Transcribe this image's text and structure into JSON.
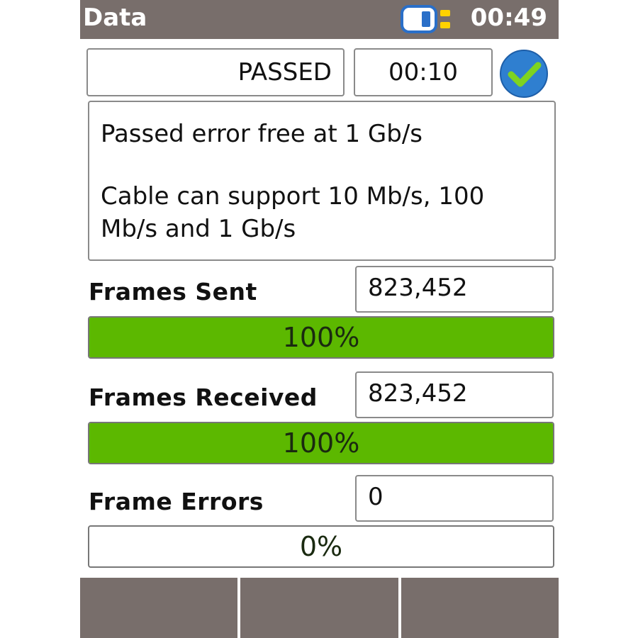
{
  "header": {
    "title": "Data",
    "time": "00:49",
    "icon": "link-status-icon"
  },
  "status": {
    "result": "PASSED",
    "elapsed": "00:10",
    "icon": "check-circle-icon",
    "accent": "#2f7fd0",
    "check_color": "#7ed321"
  },
  "message": {
    "line1": "Passed error free at 1 Gb/s",
    "line2": "Cable can support 10 Mb/s, 100",
    "line3": "Mb/s and 1 Gb/s"
  },
  "metrics": [
    {
      "label": "Frames Sent",
      "value": "823,452",
      "percent_label": "100%",
      "percent": 100
    },
    {
      "label": "Frames Received",
      "value": "823,452",
      "percent_label": "100%",
      "percent": 100
    },
    {
      "label": "Frame Errors",
      "value": "0",
      "percent_label": "0%",
      "percent": 0
    }
  ],
  "colors": {
    "header_bg": "#786e6b",
    "progress_fill": "#5cb800"
  }
}
